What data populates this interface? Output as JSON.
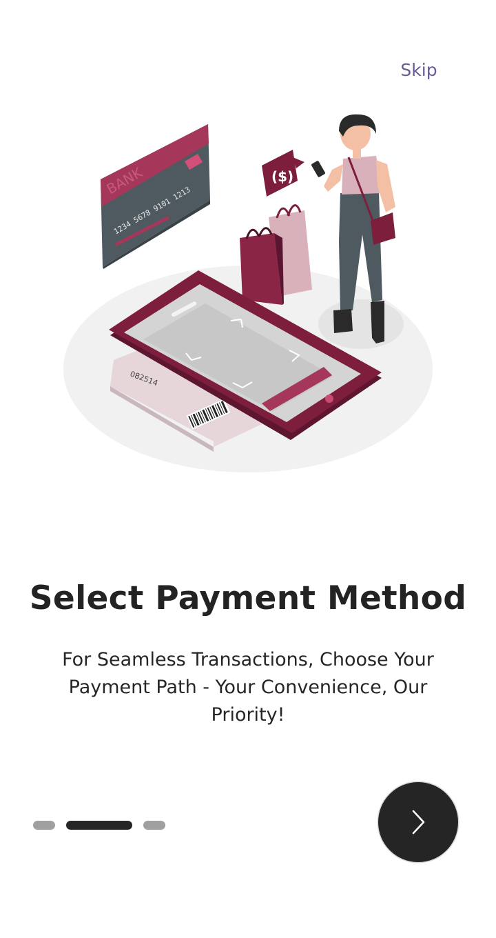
{
  "header": {
    "skip_label": "Skip"
  },
  "illustration": {
    "card_bank_text": "BANK",
    "card_number": "1234 5678 9101 1213",
    "receipt_code": "082514",
    "colors": {
      "primary": "#7d1e3c",
      "accent": "#a4375a",
      "card_gray": "#4f5a60",
      "floor": "#f0f0f0",
      "screen": "#d4d4d4"
    }
  },
  "content": {
    "title": "Select Payment Method",
    "subtitle": "For Seamless Transactions, Choose Your Payment Path - Your Convenience, Our Priority!"
  },
  "pagination": {
    "count": 3,
    "active_index": 1
  },
  "next_button": {
    "icon": "chevron-right-icon"
  }
}
